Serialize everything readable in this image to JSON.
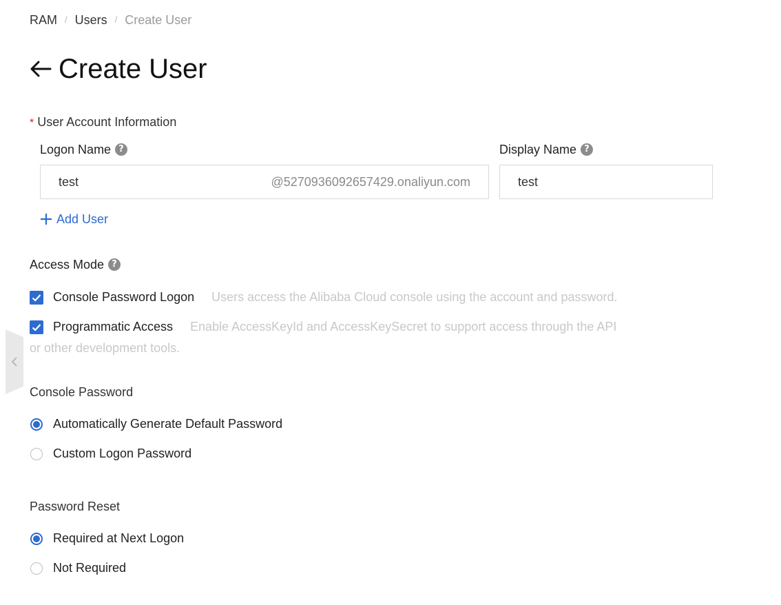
{
  "breadcrumb": {
    "items": [
      "RAM",
      "Users",
      "Create User"
    ],
    "separator": "/"
  },
  "page": {
    "title": "Create User",
    "back_icon": "arrow-left-icon"
  },
  "user_account": {
    "required_marker": "*",
    "section_label": "User Account Information",
    "logon_name_label": "Logon Name",
    "logon_name_value": "test",
    "logon_domain_suffix": "@5270936092657429.onaliyun.com",
    "display_name_label": "Display Name",
    "display_name_value": "test",
    "add_user_label": "Add User",
    "help_icon_glyph": "?"
  },
  "access_mode": {
    "label": "Access Mode",
    "options": [
      {
        "label": "Console Password Logon",
        "description": "Users access the Alibaba Cloud console using the account and password.",
        "checked": true
      },
      {
        "label": "Programmatic Access",
        "description_line1": "Enable AccessKeyId and AccessKeySecret to support access through the API",
        "description_line2": "or other development tools.",
        "checked": true
      }
    ]
  },
  "console_password": {
    "label": "Console Password",
    "options": [
      {
        "label": "Automatically Generate Default Password",
        "selected": true
      },
      {
        "label": "Custom Logon Password",
        "selected": false
      }
    ]
  },
  "password_reset": {
    "label": "Password Reset",
    "options": [
      {
        "label": "Required at Next Logon",
        "selected": true
      },
      {
        "label": "Not Required",
        "selected": false
      }
    ]
  },
  "colors": {
    "accent": "#2d6bd0",
    "required": "#e02020",
    "muted_text": "#c8c8c8"
  }
}
